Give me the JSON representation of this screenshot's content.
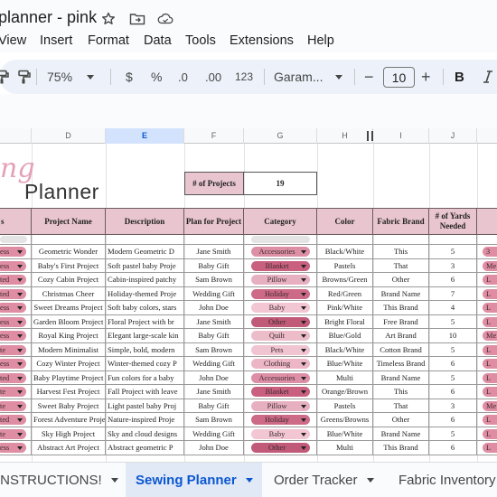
{
  "window": {
    "doc_title": "planner - pink",
    "icons": [
      "star-icon",
      "move-to-folder-icon",
      "cloud-status-icon"
    ]
  },
  "menu": [
    "View",
    "Insert",
    "Format",
    "Data",
    "Tools",
    "Extensions",
    "Help"
  ],
  "toolbar": {
    "zoom": "75%",
    "currency": "$",
    "percent": "%",
    "decrease_decimal": ".0",
    "increase_decimal": ".00",
    "number_format": "123",
    "font": "Garam...",
    "font_size": "10",
    "font_minus": "−",
    "font_plus": "+",
    "bold": "B"
  },
  "columns": [
    "D",
    "E",
    "F",
    "G",
    "H",
    "I",
    "J"
  ],
  "selected_column": "E",
  "sheet": {
    "logo_script": "ng",
    "logo_word": "Planner",
    "projects_label": "# of Projects",
    "projects_value": "19",
    "headers": [
      "s",
      "Project Name",
      "Description",
      "Plan for Project",
      "Category",
      "Color",
      "Fabric Brand",
      "# of Yards Needed"
    ],
    "rows": [
      {
        "status": "ess",
        "name": "Geometric Wonder",
        "desc": "Modern Geometric D",
        "plan": "Jane Smith",
        "category": "Accessories",
        "color": "Black/White",
        "brand": "This",
        "yards": "5",
        "k": "3"
      },
      {
        "status": "ess",
        "name": "Baby's First Project",
        "desc": "Soft pastel baby Proje",
        "plan": "Baby Gift",
        "category": "Blanket",
        "color": "Pastels",
        "brand": "That",
        "yards": "3",
        "k": "Me"
      },
      {
        "status": "ted",
        "name": "Cozy Cabin Project",
        "desc": "Cabin-inspired patchy",
        "plan": "Sam Brown",
        "category": "Pillow",
        "color": "Browns/Green",
        "brand": "Other",
        "yards": "6",
        "k": "L"
      },
      {
        "status": "ted",
        "name": "Christmas Cheer",
        "desc": "Holiday-themed Proje",
        "plan": "Wedding Gift",
        "category": "Holiday",
        "color": "Red/Green",
        "brand": "Brand Name",
        "yards": "7",
        "k": "L"
      },
      {
        "status": "ess",
        "name": "Sweet Dreams Project",
        "desc": "Soft baby colors, stars",
        "plan": "John Doe",
        "category": "Baby",
        "color": "Pink/White",
        "brand": "This Brand",
        "yards": "4",
        "k": "L"
      },
      {
        "status": "ess",
        "name": "Garden Bloom Project",
        "desc": "Floral Project with br",
        "plan": "Jane Smith",
        "category": "Other",
        "color": "Bright Floral",
        "brand": "Free Brand",
        "yards": "5",
        "k": "L"
      },
      {
        "status": "ess",
        "name": "Royal King Project",
        "desc": "Elegant large-scale kin",
        "plan": "Baby Gift",
        "category": "Quilt",
        "color": "Blue/Gold",
        "brand": "Art Brand",
        "yards": "10",
        "k": "Me"
      },
      {
        "status": "te",
        "name": "Modern Minimalist",
        "desc": "Simple, bold, modern",
        "plan": "Sam Brown",
        "category": "Pets",
        "color": "Black/White",
        "brand": "Cotton Brand",
        "yards": "5",
        "k": "L"
      },
      {
        "status": "ess",
        "name": "Cozy Winter Project",
        "desc": "Winter-themed cozy P",
        "plan": "Wedding Gift",
        "category": "Clothing",
        "color": "Blue/White",
        "brand": "Timeless Brand",
        "yards": "6",
        "k": "L"
      },
      {
        "status": "ted",
        "name": "Baby Playtime Project",
        "desc": "Fun colors for a baby",
        "plan": "John Doe",
        "category": "Accessories",
        "color": "Multi",
        "brand": "Brand Name",
        "yards": "5",
        "k": "L"
      },
      {
        "status": "te",
        "name": "Harvest Fest Project",
        "desc": "Fall Project with leave",
        "plan": "Jane Smith",
        "category": "Blanket",
        "color": "Orange/Brown",
        "brand": "This",
        "yards": "6",
        "k": "L"
      },
      {
        "status": "te",
        "name": "Sweet Baby Project",
        "desc": "Light pastel baby Proj",
        "plan": "Baby Gift",
        "category": "Pillow",
        "color": "Pastels",
        "brand": "That",
        "yards": "3",
        "k": "Me"
      },
      {
        "status": "ted",
        "name": "Forest Adventure Proje",
        "desc": "Nature-inspired Proje",
        "plan": "Sam Brown",
        "category": "Holiday",
        "color": "Greens/Browns",
        "brand": "Other",
        "yards": "6",
        "k": "L"
      },
      {
        "status": "te",
        "name": "Sky High Project",
        "desc": "Sky and cloud designs",
        "plan": "Wedding Gift",
        "category": "Baby",
        "color": "Blue/White",
        "brand": "Brand Name",
        "yards": "5",
        "k": "L"
      },
      {
        "status": "ess",
        "name": "Abstract Art Project",
        "desc": "Abstract geometric P",
        "plan": "John Doe",
        "category": "Other",
        "color": "Multi",
        "brand": "This Brand",
        "yards": "6",
        "k": "L"
      }
    ]
  },
  "colors": {
    "header_pink": "#e8c5cf",
    "status_chip": "#df8da3",
    "category_chips": {
      "Accessories": "#dd8fa6",
      "Blanket": "#c9607f",
      "Pillow": "#e6b0c0",
      "Holiday": "#cd6a87",
      "Baby": "#f3c6d3",
      "Other": "#c05a78",
      "Quilt": "#ecbcc9",
      "Pets": "#f1c4d1",
      "Clothing": "#ecb6c6"
    },
    "tab_active": "#0b57d0"
  },
  "tabs": [
    {
      "label": "INSTRUCTIONS!",
      "active": false
    },
    {
      "label": "Sewing Planner",
      "active": true
    },
    {
      "label": "Order Tracker",
      "active": false
    },
    {
      "label": "Fabric Inventory",
      "active": false
    }
  ]
}
